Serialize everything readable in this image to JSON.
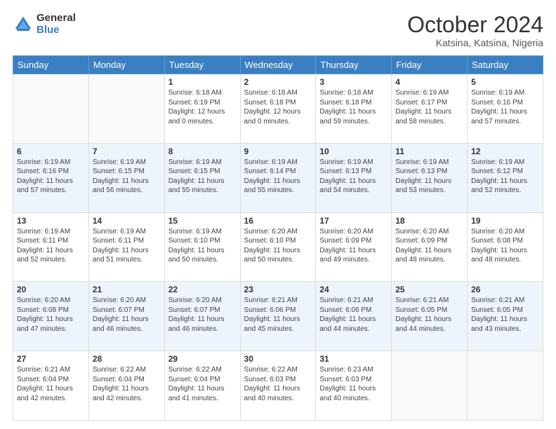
{
  "logo": {
    "general": "General",
    "blue": "Blue"
  },
  "title": "October 2024",
  "subtitle": "Katsina, Katsina, Nigeria",
  "days_of_week": [
    "Sunday",
    "Monday",
    "Tuesday",
    "Wednesday",
    "Thursday",
    "Friday",
    "Saturday"
  ],
  "weeks": [
    [
      {
        "day": "",
        "info": ""
      },
      {
        "day": "",
        "info": ""
      },
      {
        "day": "1",
        "sunrise": "6:18 AM",
        "sunset": "6:19 PM",
        "daylight": "12 hours and 0 minutes."
      },
      {
        "day": "2",
        "sunrise": "6:18 AM",
        "sunset": "6:18 PM",
        "daylight": "12 hours and 0 minutes."
      },
      {
        "day": "3",
        "sunrise": "6:18 AM",
        "sunset": "6:18 PM",
        "daylight": "11 hours and 59 minutes."
      },
      {
        "day": "4",
        "sunrise": "6:19 AM",
        "sunset": "6:17 PM",
        "daylight": "11 hours and 58 minutes."
      },
      {
        "day": "5",
        "sunrise": "6:19 AM",
        "sunset": "6:16 PM",
        "daylight": "11 hours and 57 minutes."
      }
    ],
    [
      {
        "day": "6",
        "sunrise": "6:19 AM",
        "sunset": "6:16 PM",
        "daylight": "11 hours and 57 minutes."
      },
      {
        "day": "7",
        "sunrise": "6:19 AM",
        "sunset": "6:15 PM",
        "daylight": "11 hours and 56 minutes."
      },
      {
        "day": "8",
        "sunrise": "6:19 AM",
        "sunset": "6:15 PM",
        "daylight": "11 hours and 55 minutes."
      },
      {
        "day": "9",
        "sunrise": "6:19 AM",
        "sunset": "6:14 PM",
        "daylight": "11 hours and 55 minutes."
      },
      {
        "day": "10",
        "sunrise": "6:19 AM",
        "sunset": "6:13 PM",
        "daylight": "11 hours and 54 minutes."
      },
      {
        "day": "11",
        "sunrise": "6:19 AM",
        "sunset": "6:13 PM",
        "daylight": "11 hours and 53 minutes."
      },
      {
        "day": "12",
        "sunrise": "6:19 AM",
        "sunset": "6:12 PM",
        "daylight": "11 hours and 52 minutes."
      }
    ],
    [
      {
        "day": "13",
        "sunrise": "6:19 AM",
        "sunset": "6:11 PM",
        "daylight": "11 hours and 52 minutes."
      },
      {
        "day": "14",
        "sunrise": "6:19 AM",
        "sunset": "6:11 PM",
        "daylight": "11 hours and 51 minutes."
      },
      {
        "day": "15",
        "sunrise": "6:19 AM",
        "sunset": "6:10 PM",
        "daylight": "11 hours and 50 minutes."
      },
      {
        "day": "16",
        "sunrise": "6:20 AM",
        "sunset": "6:10 PM",
        "daylight": "11 hours and 50 minutes."
      },
      {
        "day": "17",
        "sunrise": "6:20 AM",
        "sunset": "6:09 PM",
        "daylight": "11 hours and 49 minutes."
      },
      {
        "day": "18",
        "sunrise": "6:20 AM",
        "sunset": "6:09 PM",
        "daylight": "11 hours and 48 minutes."
      },
      {
        "day": "19",
        "sunrise": "6:20 AM",
        "sunset": "6:08 PM",
        "daylight": "11 hours and 48 minutes."
      }
    ],
    [
      {
        "day": "20",
        "sunrise": "6:20 AM",
        "sunset": "6:08 PM",
        "daylight": "11 hours and 47 minutes."
      },
      {
        "day": "21",
        "sunrise": "6:20 AM",
        "sunset": "6:07 PM",
        "daylight": "11 hours and 46 minutes."
      },
      {
        "day": "22",
        "sunrise": "6:20 AM",
        "sunset": "6:07 PM",
        "daylight": "11 hours and 46 minutes."
      },
      {
        "day": "23",
        "sunrise": "6:21 AM",
        "sunset": "6:06 PM",
        "daylight": "11 hours and 45 minutes."
      },
      {
        "day": "24",
        "sunrise": "6:21 AM",
        "sunset": "6:06 PM",
        "daylight": "11 hours and 44 minutes."
      },
      {
        "day": "25",
        "sunrise": "6:21 AM",
        "sunset": "6:05 PM",
        "daylight": "11 hours and 44 minutes."
      },
      {
        "day": "26",
        "sunrise": "6:21 AM",
        "sunset": "6:05 PM",
        "daylight": "11 hours and 43 minutes."
      }
    ],
    [
      {
        "day": "27",
        "sunrise": "6:21 AM",
        "sunset": "6:04 PM",
        "daylight": "11 hours and 42 minutes."
      },
      {
        "day": "28",
        "sunrise": "6:22 AM",
        "sunset": "6:04 PM",
        "daylight": "11 hours and 42 minutes."
      },
      {
        "day": "29",
        "sunrise": "6:22 AM",
        "sunset": "6:04 PM",
        "daylight": "11 hours and 41 minutes."
      },
      {
        "day": "30",
        "sunrise": "6:22 AM",
        "sunset": "6:03 PM",
        "daylight": "11 hours and 40 minutes."
      },
      {
        "day": "31",
        "sunrise": "6:23 AM",
        "sunset": "6:03 PM",
        "daylight": "11 hours and 40 minutes."
      },
      {
        "day": "",
        "info": ""
      },
      {
        "day": "",
        "info": ""
      }
    ]
  ],
  "labels": {
    "sunrise": "Sunrise:",
    "sunset": "Sunset:",
    "daylight": "Daylight:"
  }
}
